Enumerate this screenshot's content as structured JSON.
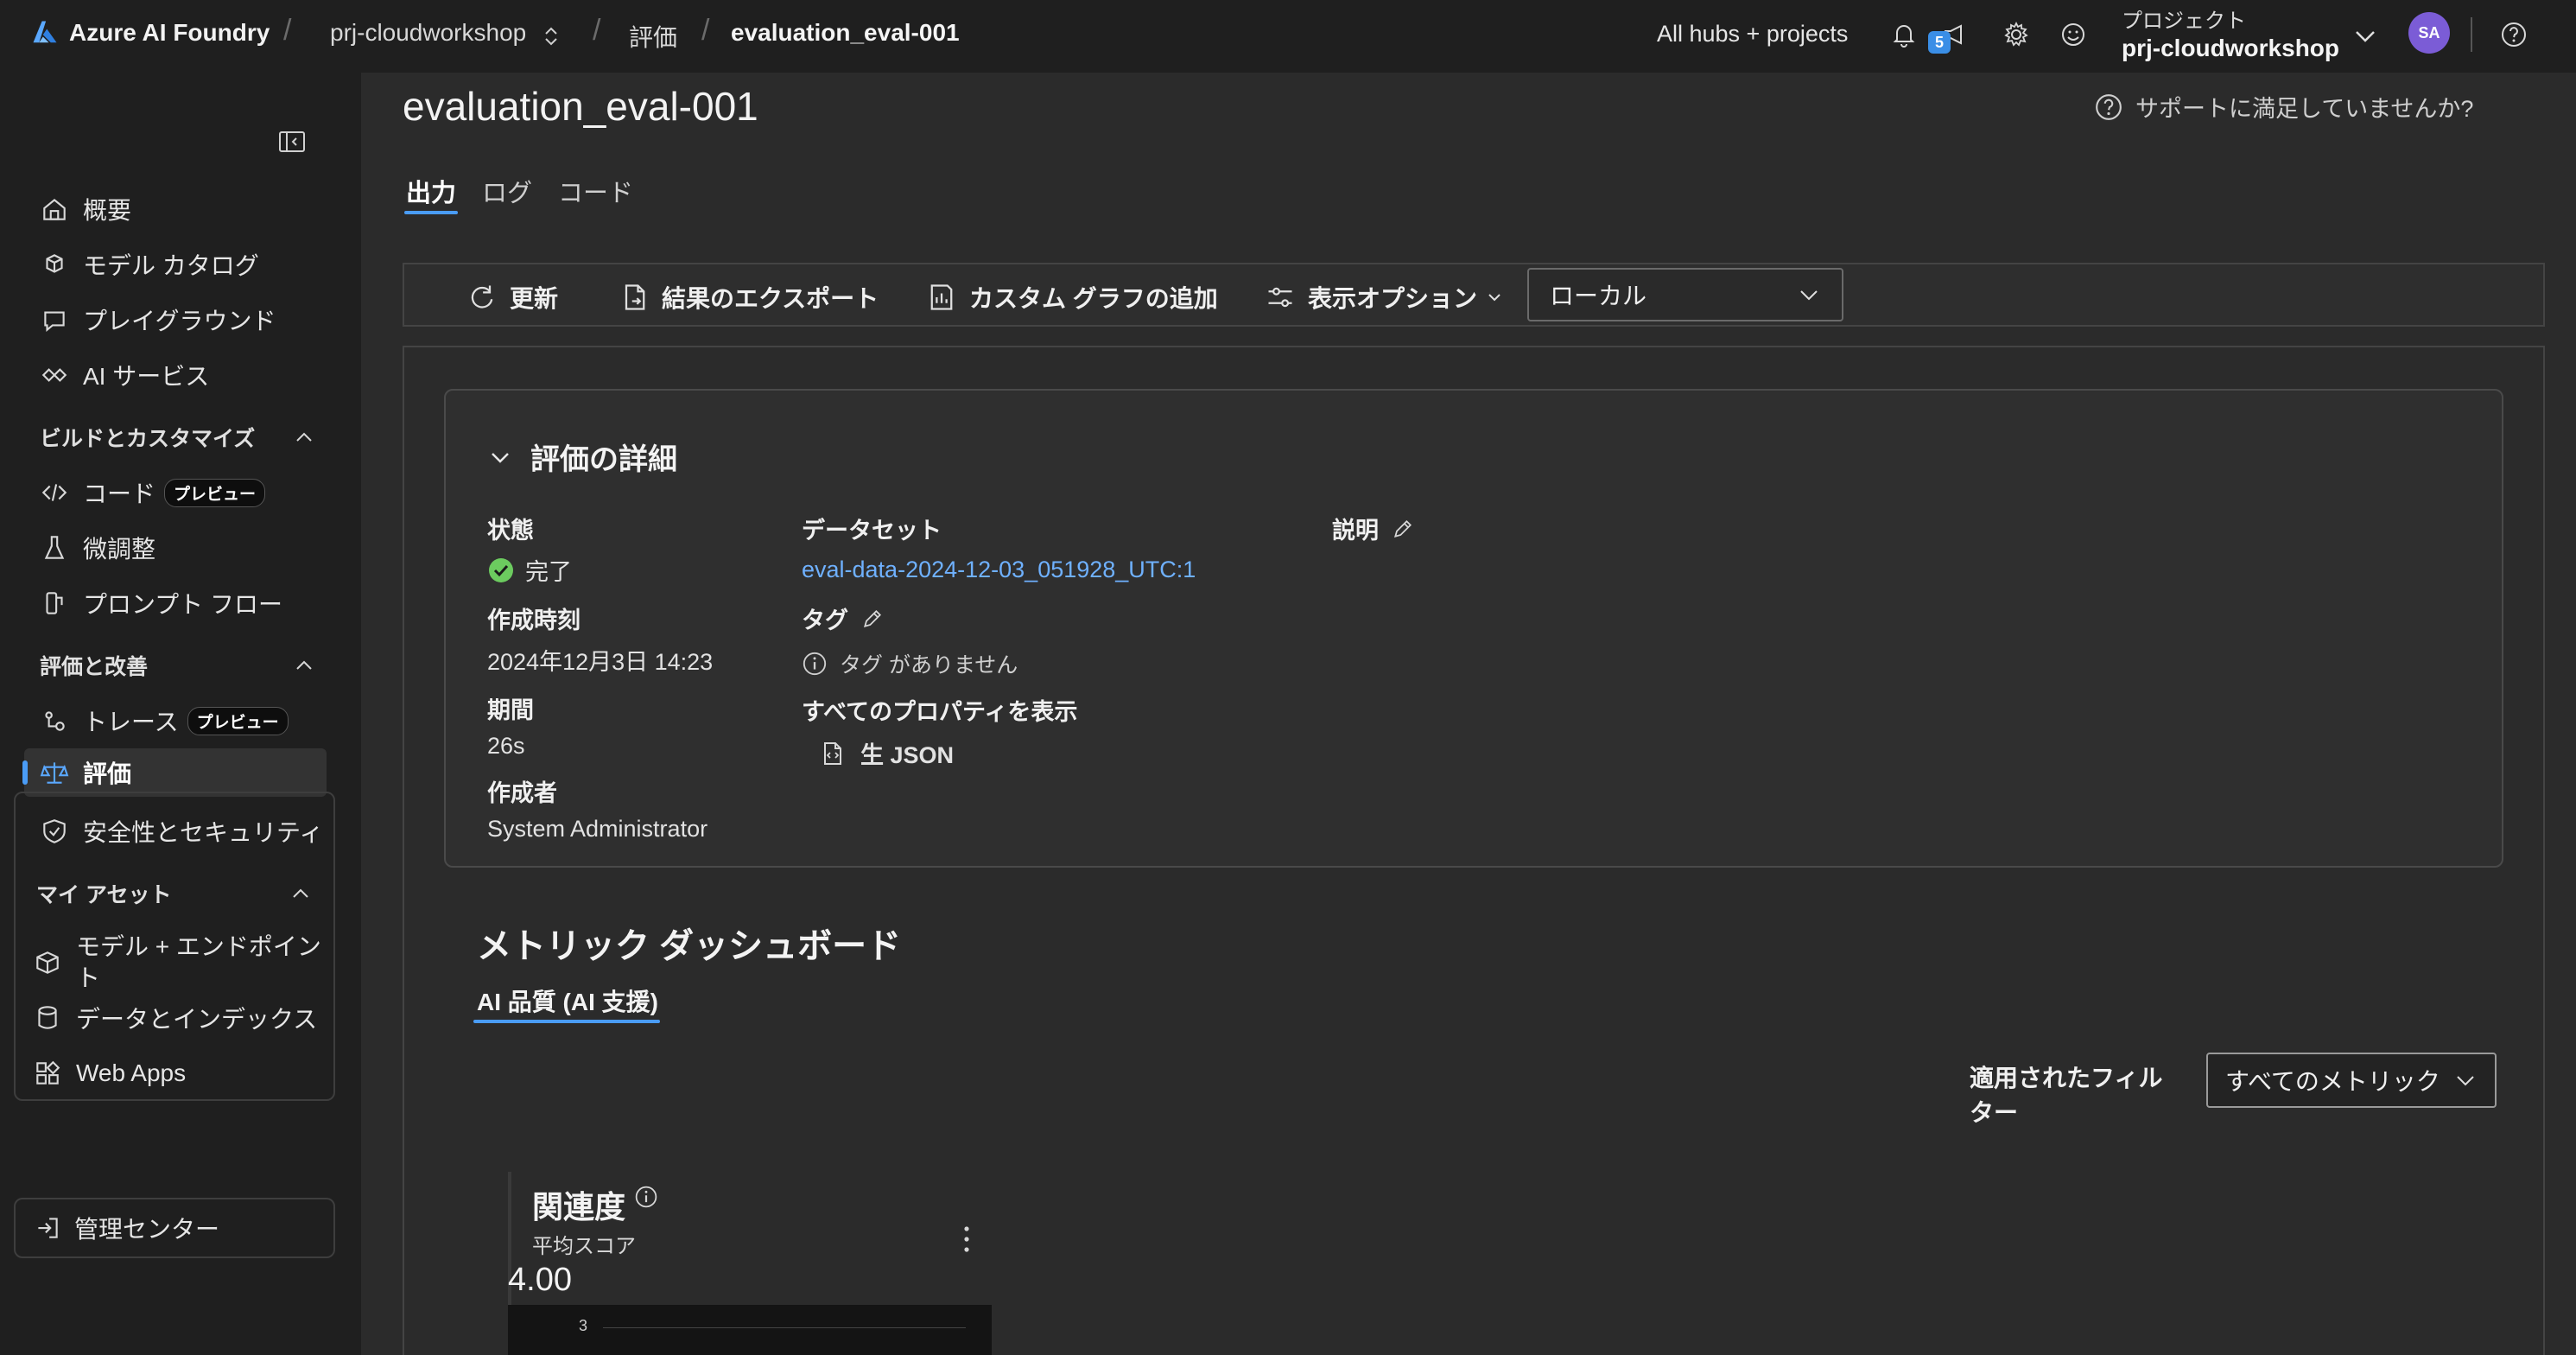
{
  "topbar": {
    "brand": "Azure AI Foundry",
    "breadcrumb_project": "prj-cloudworkshop",
    "breadcrumb_section": "評価",
    "breadcrumb_current": "evaluation_eval-001",
    "hubs_link": "All hubs + projects",
    "notification_count": "5",
    "project_label": "プロジェクト",
    "project_name": "prj-cloudworkshop",
    "avatar_initials": "SA"
  },
  "sidebar": {
    "items_top": [
      {
        "label": "概要",
        "icon": "home-icon"
      },
      {
        "label": "モデル カタログ",
        "icon": "cube-stack-icon"
      },
      {
        "label": "プレイグラウンド",
        "icon": "chat-icon"
      },
      {
        "label": "AI サービス",
        "icon": "link-icon"
      }
    ],
    "section_build": "ビルドとカスタマイズ",
    "items_build": [
      {
        "label": "コード",
        "badge": "プレビュー"
      },
      {
        "label": "微調整"
      },
      {
        "label": "プロンプト フロー"
      }
    ],
    "section_eval": "評価と改善",
    "items_eval": [
      {
        "label": "トレース",
        "badge": "プレビュー"
      },
      {
        "label": "評価"
      },
      {
        "label": "安全性とセキュリティ"
      }
    ],
    "section_assets": "マイ アセット",
    "items_assets": [
      {
        "label": "モデル + エンドポイント"
      },
      {
        "label": "データとインデックス"
      },
      {
        "label": "Web Apps"
      }
    ],
    "admin_center": "管理センター"
  },
  "main": {
    "title": "evaluation_eval-001",
    "help_text": "サポートに満足していませんか?",
    "tabs": [
      {
        "label": "出力"
      },
      {
        "label": "ログ"
      },
      {
        "label": "コード"
      }
    ],
    "toolbar": {
      "refresh": "更新",
      "export": "結果のエクスポート",
      "add_chart": "カスタム グラフの追加",
      "view_options": "表示オプション",
      "location_value": "ローカル"
    },
    "details": {
      "header": "評価の詳細",
      "status_label": "状態",
      "status_value": "完了",
      "created_label": "作成時刻",
      "created_value": "2024年12月3日 14:23",
      "duration_label": "期間",
      "duration_value": "26s",
      "author_label": "作成者",
      "author_value": "System Administrator",
      "dataset_label": "データセット",
      "dataset_value": "eval-data-2024-12-03_051928_UTC:1",
      "tags_label": "タグ",
      "tags_empty": "タグ がありません",
      "properties_label": "すべてのプロパティを表示",
      "raw_json": "生 JSON",
      "description_label": "説明"
    },
    "dashboard": {
      "title": "メトリック ダッシュボード",
      "tab": "AI 品質 (AI 支援)",
      "filter_label": "適用されたフィルター",
      "filter_value": "すべてのメトリック",
      "metric": {
        "title": "関連度",
        "subtitle": "平均スコア",
        "score": "4.00",
        "chart_tick": "3"
      }
    }
  },
  "colors": {
    "accent": "#4a9cf6",
    "link": "#6fb1ff",
    "success": "#6ccb5f",
    "background": "#2b2b2b",
    "sidebar": "#1f1f1f"
  }
}
